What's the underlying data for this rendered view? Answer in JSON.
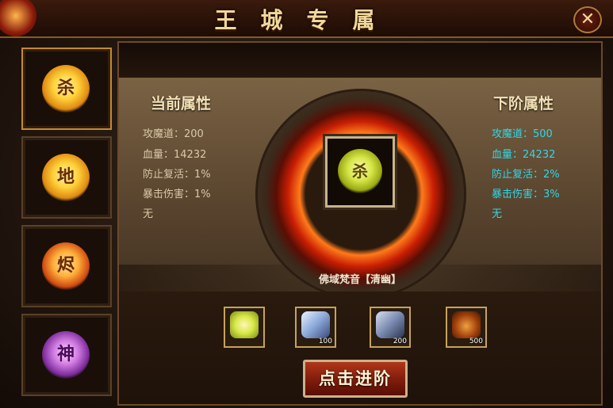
{
  "window": {
    "title": "王城专属",
    "close_label": "✕"
  },
  "side_items": [
    {
      "glyph": "杀",
      "selected": true
    },
    {
      "glyph": "地",
      "selected": false
    },
    {
      "glyph": "烬",
      "selected": false
    },
    {
      "glyph": "神",
      "selected": false
    }
  ],
  "current": {
    "header": "当前属性",
    "lines": [
      "攻魔道：200",
      "血量：14232",
      "防止复活：1%",
      "暴击伤害：1%",
      "无"
    ]
  },
  "next": {
    "header": "下阶属性",
    "lines": [
      "攻魔道：500",
      "血量：24232",
      "防止复活：2%",
      "暴击伤害：3%",
      "无"
    ]
  },
  "center": {
    "glyph": "杀"
  },
  "item_name": "佛域梵音【清幽】",
  "costs": [
    {
      "icon": "talisman-icon",
      "count": ""
    },
    {
      "icon": "crystal-icon",
      "count": "100"
    },
    {
      "icon": "ore-icon",
      "count": "200"
    },
    {
      "icon": "bag-icon",
      "count": "500"
    }
  ],
  "advance_label": "点击进阶",
  "colors": {
    "current_text": "#d8c9a8",
    "next_text": "#2fd8e8",
    "accent": "#c7a25a"
  }
}
